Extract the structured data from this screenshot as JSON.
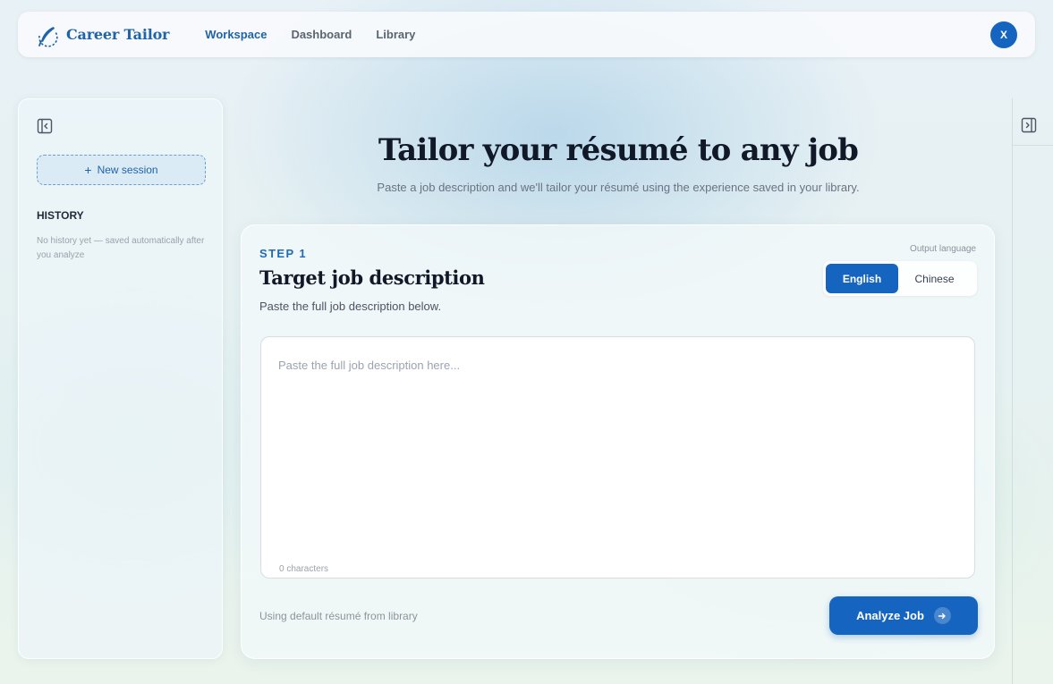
{
  "app": {
    "name": "Career Tailor"
  },
  "nav": {
    "items": [
      {
        "label": "Workspace",
        "active": true
      },
      {
        "label": "Dashboard",
        "active": false
      },
      {
        "label": "Library",
        "active": false
      }
    ]
  },
  "user": {
    "avatar_initial": "X"
  },
  "sidebar": {
    "collapse_icon": "sidebar-collapse-left-icon",
    "new_session_label": "New session",
    "history_title": "HISTORY",
    "history_empty": "No history yet — saved automatically after you analyze"
  },
  "right_panel": {
    "expand_icon": "sidebar-expand-right-icon"
  },
  "hero": {
    "title": "Tailor your résumé to any job",
    "subtitle": "Paste a job description and we'll tailor your résumé using the experience saved in your library."
  },
  "card": {
    "step_label": "STEP 1",
    "title": "Target job description",
    "subtitle": "Paste the full job description below.",
    "output_language_label": "Output language",
    "languages": [
      {
        "label": "English",
        "selected": true
      },
      {
        "label": "Chinese",
        "selected": false
      }
    ],
    "jd_placeholder": "Paste the full job description here...",
    "jd_value": "",
    "char_count": "0 characters",
    "resume_note": "Using default résumé from library",
    "analyze_label": "Analyze Job"
  },
  "colors": {
    "accent": "#1565c0",
    "brand_text": "#1f63a8"
  }
}
